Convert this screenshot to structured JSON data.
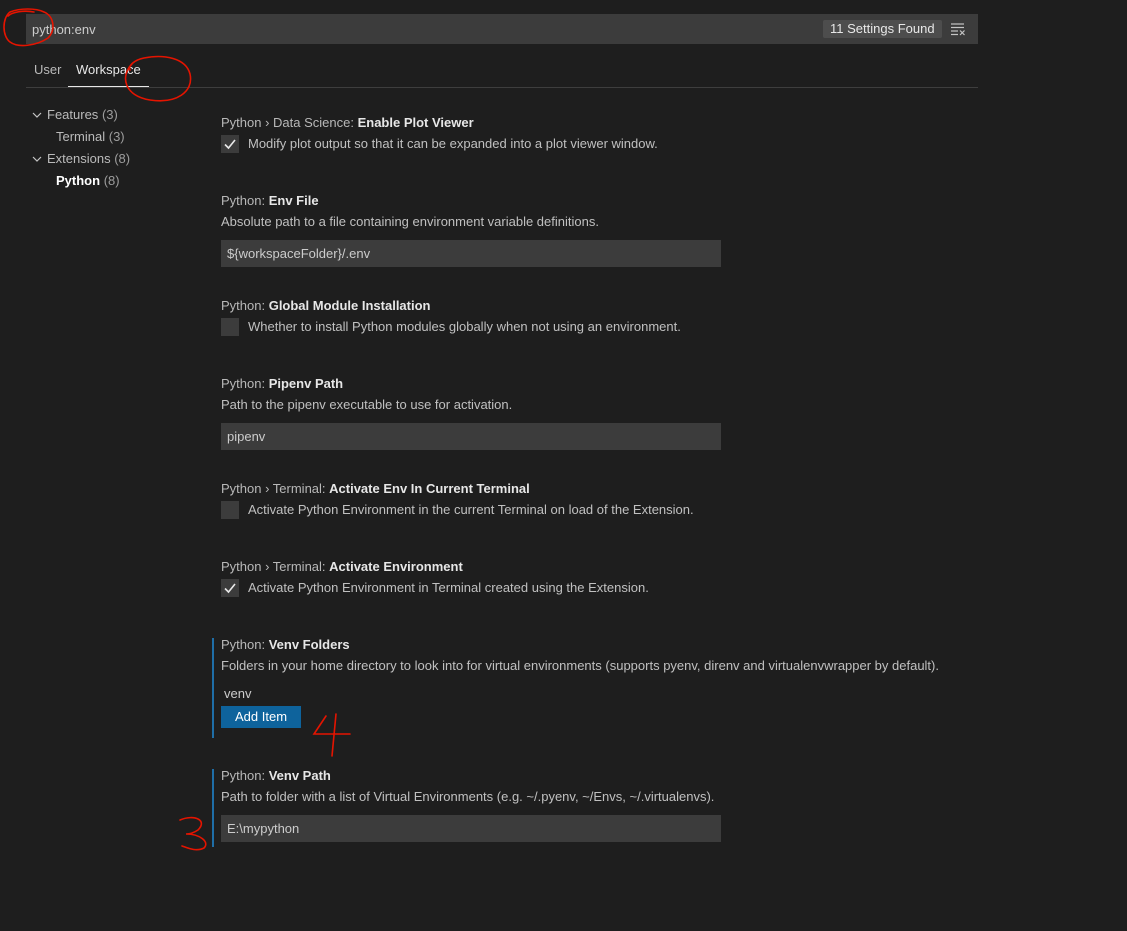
{
  "search": {
    "value": "python:env",
    "count_badge": "11 Settings Found"
  },
  "tabs": [
    {
      "label": "User"
    },
    {
      "label": "Workspace"
    }
  ],
  "tree": [
    {
      "label": "Features",
      "count": "(3)"
    },
    {
      "label": "Terminal",
      "count": "(3)"
    },
    {
      "label": "Extensions",
      "count": "(8)"
    },
    {
      "label": "Python",
      "count": "(8)"
    }
  ],
  "settings": [
    {
      "category": "Python › Data Science: ",
      "name": "Enable Plot Viewer",
      "description": "Modify plot output so that it can be expanded into a plot viewer window.",
      "checked": true
    },
    {
      "category": "Python: ",
      "name": "Env File",
      "description": "Absolute path to a file containing environment variable definitions.",
      "value": "${workspaceFolder}/.env"
    },
    {
      "category": "Python: ",
      "name": "Global Module Installation",
      "description": "Whether to install Python modules globally when not using an environment.",
      "checked": false
    },
    {
      "category": "Python: ",
      "name": "Pipenv Path",
      "description": "Path to the pipenv executable to use for activation.",
      "value": "pipenv"
    },
    {
      "category": "Python › Terminal: ",
      "name": "Activate Env In Current Terminal",
      "description": "Activate Python Environment in the current Terminal on load of the Extension.",
      "checked": false
    },
    {
      "category": "Python › Terminal: ",
      "name": "Activate Environment",
      "description": "Activate Python Environment in Terminal created using the Extension.",
      "checked": true
    },
    {
      "category": "Python: ",
      "name": "Venv Folders",
      "description": "Folders in your home directory to look into for virtual environments (supports pyenv, direnv and virtualenvwrapper by default).",
      "items": [
        "venv"
      ],
      "add_button": "Add Item"
    },
    {
      "category": "Python: ",
      "name": "Venv Path",
      "description": "Path to folder with a list of Virtual Environments (e.g. ~/.pyenv, ~/Envs, ~/.virtualenvs).",
      "value": "E:\\mypython"
    }
  ],
  "colors": {
    "background": "#1e1e1e",
    "input": "#3c3c3c",
    "button": "#0e639c",
    "focus": "#1f6ea7",
    "annotation": "#e51400"
  }
}
